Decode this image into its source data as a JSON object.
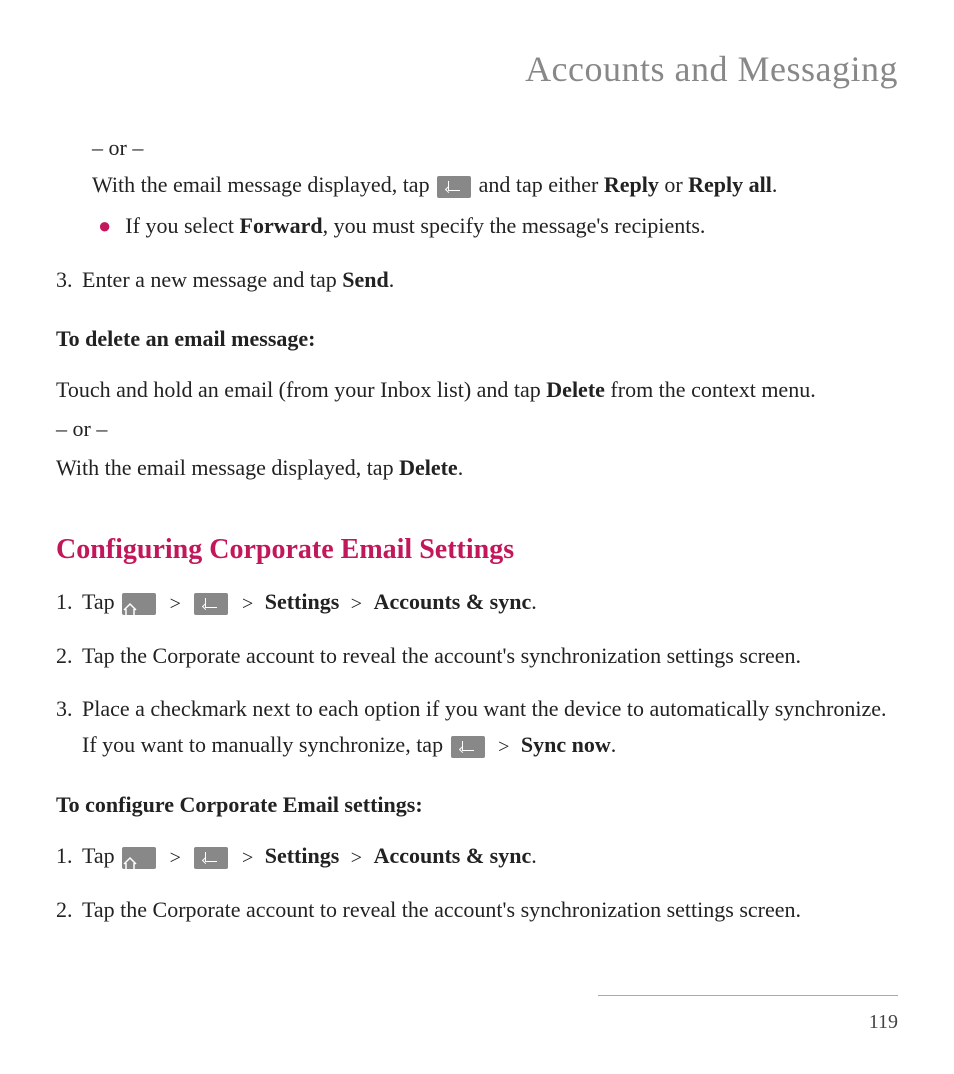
{
  "header": "Accounts and Messaging",
  "top": {
    "or": "– or –",
    "with_email_pre": "With the email message displayed, tap ",
    "with_email_post": " and tap either ",
    "reply": "Reply",
    "or_text": " or ",
    "reply_all": "Reply all",
    "period": ".",
    "bullet_pre": "If you select ",
    "forward": "Forward",
    "bullet_post": ", you must specify the message's recipients."
  },
  "step3": {
    "num": "3.",
    "pre": "Enter a new message and tap ",
    "send": "Send",
    "post": "."
  },
  "delete_heading": "To delete an email message:",
  "delete_para1_pre": "Touch and hold an email (from your Inbox list) and tap ",
  "delete_bold": "Delete",
  "delete_para1_post": " from the context menu.",
  "delete_or": "– or –",
  "delete_para2_pre": "With the email message displayed, tap ",
  "delete_para2_bold": "Delete",
  "delete_para2_post": ".",
  "section_title": "Configuring Corporate Email Settings",
  "cfg1": {
    "num": "1.",
    "pre": "Tap ",
    "settings": "Settings",
    "accounts": "Accounts & sync",
    "post": "."
  },
  "cfg2": {
    "num": "2.",
    "text": "Tap the Corporate account to reveal the account's synchronization settings screen."
  },
  "cfg3": {
    "num": "3.",
    "pre": "Place a checkmark next to each option if you want the device to automatically synchronize. If you want to manually synchronize, tap ",
    "sync": "Sync now",
    "post": "."
  },
  "configure_heading": "To configure Corporate Email settings:",
  "cc1": {
    "num": "1.",
    "pre": "Tap ",
    "settings": "Settings",
    "accounts": "Accounts & sync",
    "post": "."
  },
  "cc2": {
    "num": "2.",
    "text": "Tap the Corporate account to reveal the account's synchronization settings screen."
  },
  "gt": ">",
  "page_number": "119"
}
